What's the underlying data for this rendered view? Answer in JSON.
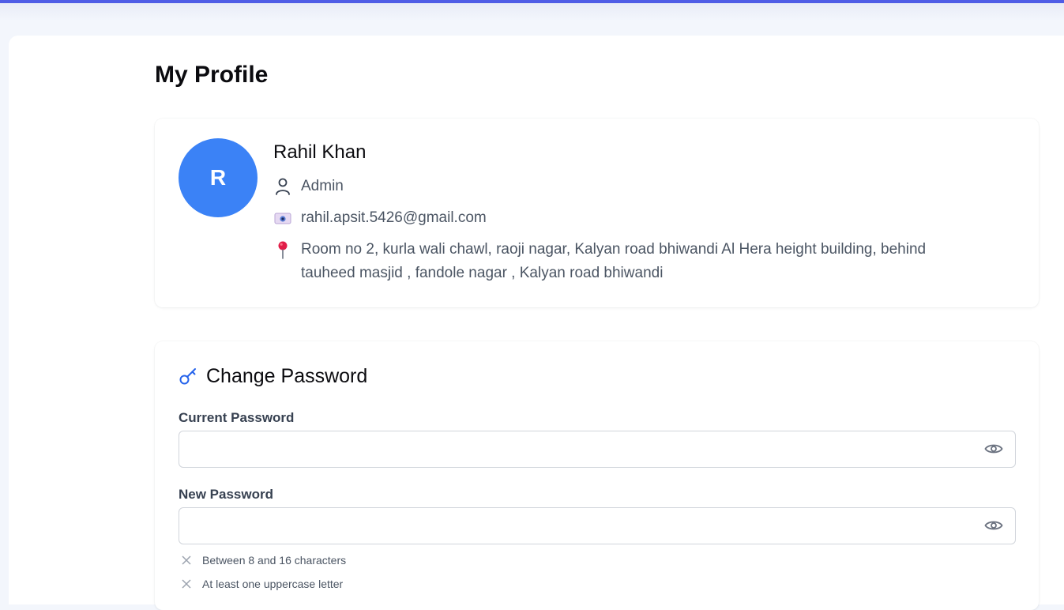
{
  "page": {
    "title": "My Profile",
    "accent_color": "#4f5de6"
  },
  "profile": {
    "avatar_initial": "R",
    "avatar_color": "#3b82f6",
    "name": "Rahil Khan",
    "role": "Admin",
    "email": "rahil.apsit.5426@gmail.com",
    "address": "Room no 2, kurla wali chawl, raoji nagar, Kalyan road bhiwandi Al Hera height building, behind tauheed masjid , fandole nagar , Kalyan road bhiwandi",
    "icons": {
      "role": "user-icon",
      "email": "email-icon",
      "address": "map-pin-icon"
    }
  },
  "change_password": {
    "title": "Change Password",
    "icon": "key-icon",
    "current_password": {
      "label": "Current Password",
      "value": "",
      "placeholder": ""
    },
    "new_password": {
      "label": "New Password",
      "value": "",
      "placeholder": ""
    },
    "rules": [
      {
        "text": "Between 8 and 16 characters",
        "met": false
      },
      {
        "text": "At least one uppercase letter",
        "met": false
      }
    ]
  }
}
